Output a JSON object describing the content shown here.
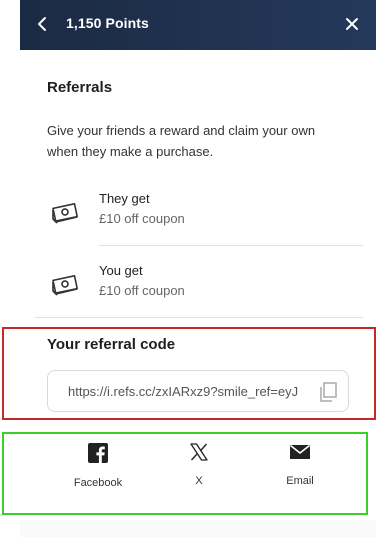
{
  "header": {
    "title": "1,150 Points"
  },
  "referrals": {
    "title": "Referrals",
    "description": "Give your friends a reward and claim your own when they make a purchase.",
    "rewards": [
      {
        "label": "They get",
        "value": "£10 off coupon",
        "icon": "cash-icon"
      },
      {
        "label": "You get",
        "value": "£10 off coupon",
        "icon": "cash-icon"
      }
    ]
  },
  "referral_code": {
    "title": "Your referral code",
    "value": "https://i.refs.cc/zxIARxz9?smile_ref=eyJ",
    "copy_icon": "copy-icon"
  },
  "share": {
    "items": [
      {
        "label": "Facebook",
        "icon": "facebook-icon"
      },
      {
        "label": "X",
        "icon": "x-icon"
      },
      {
        "label": "Email",
        "icon": "email-icon"
      }
    ]
  },
  "colors": {
    "header_bg": "#1b2a44",
    "highlight_red": "#c62828",
    "highlight_green": "#3ccf2a"
  }
}
